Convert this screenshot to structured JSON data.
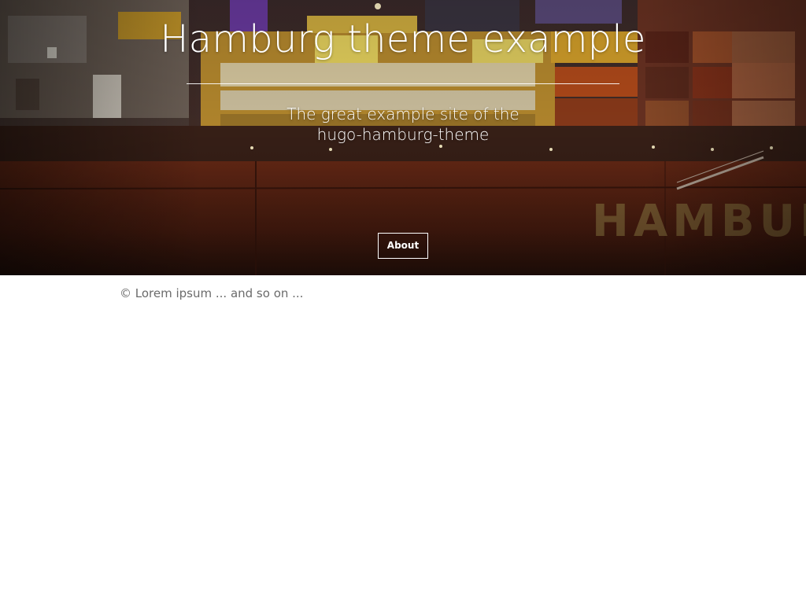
{
  "header": {
    "title": "Hamburg theme example",
    "subtitle": "The great example site of the hugo-hamburg-theme",
    "hero_image": "container ship at night with HAMBURG lettering on the hull"
  },
  "nav": {
    "items": [
      {
        "label": "About"
      }
    ]
  },
  "footer": {
    "text": "© Lorem ipsum ... and so on ..."
  },
  "colors": {
    "title_text": "#ffffff",
    "footer_text": "#6b6b6b",
    "hull": "#5a2414",
    "background": "#ffffff"
  }
}
